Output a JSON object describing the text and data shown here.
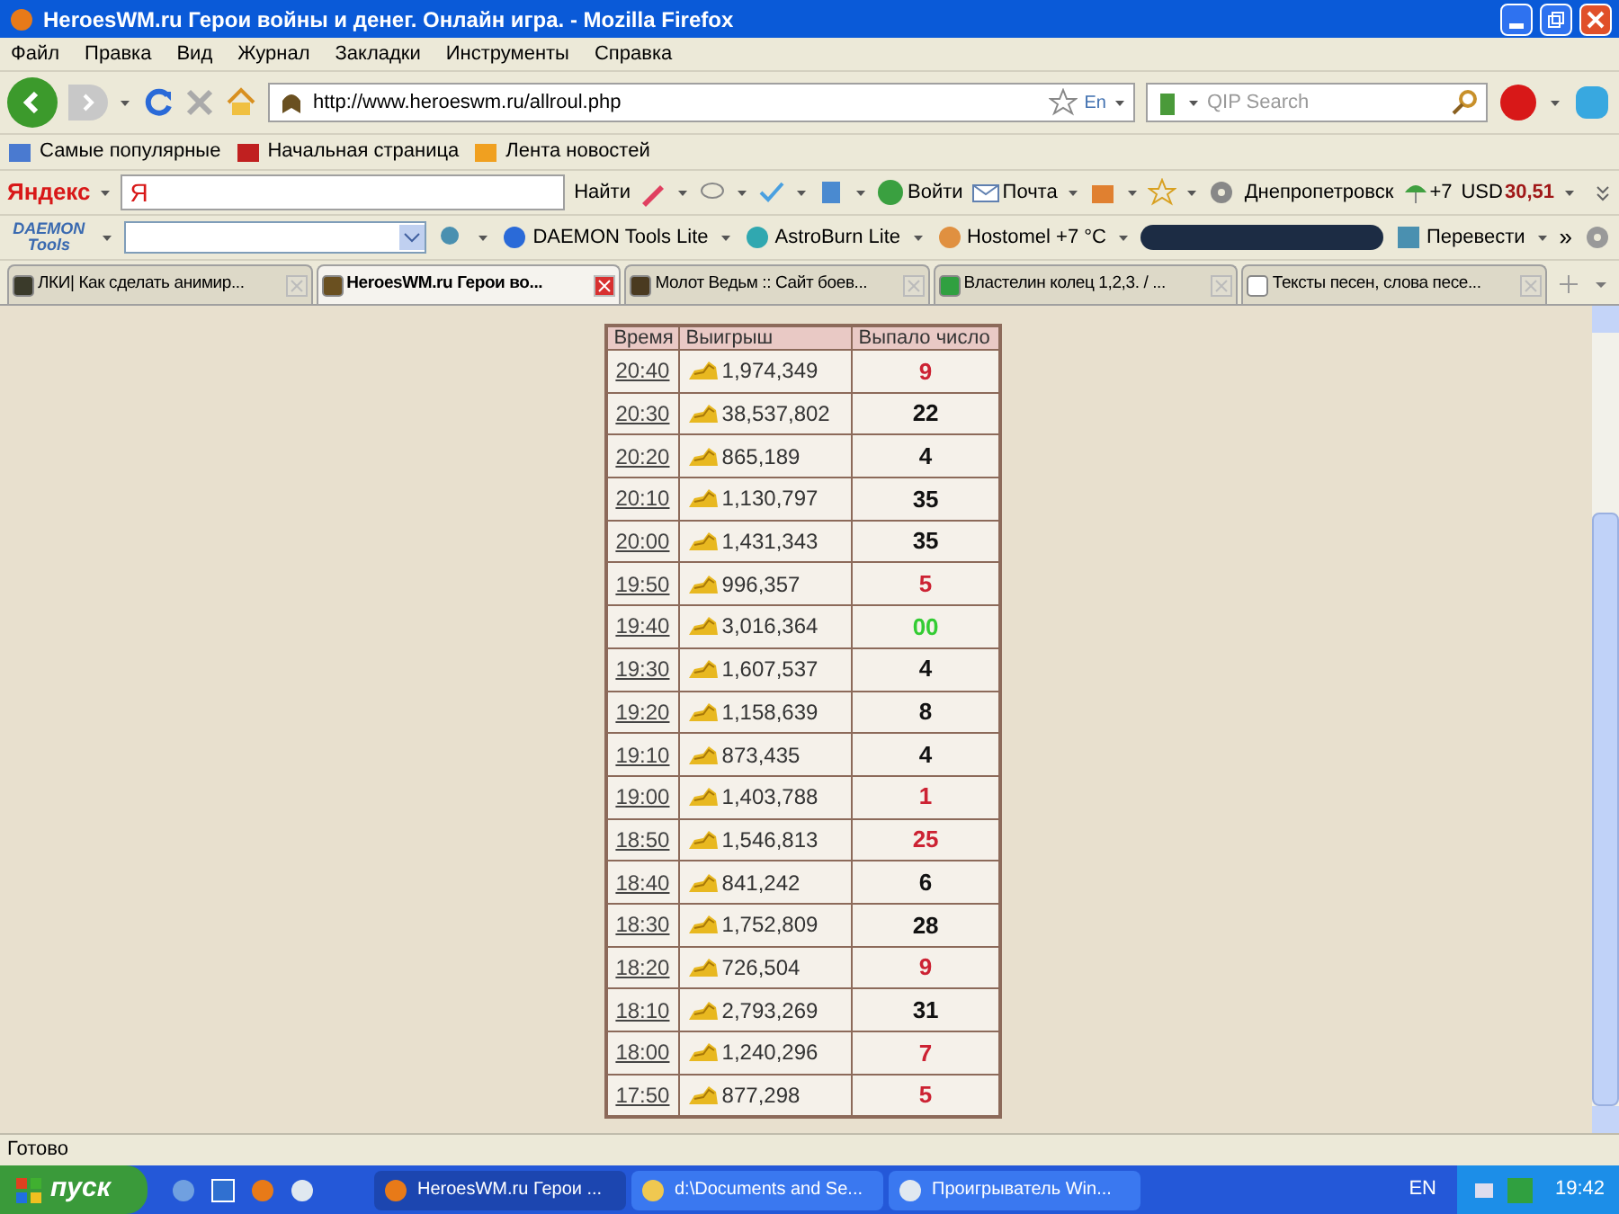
{
  "window": {
    "title": "HeroesWM.ru Герои войны и денег. Онлайн игра. - Mozilla Firefox"
  },
  "menu": [
    "Файл",
    "Правка",
    "Вид",
    "Журнал",
    "Закладки",
    "Инструменты",
    "Справка"
  ],
  "navbar": {
    "url": "http://www.heroeswm.ru/allroul.php",
    "lang": "En",
    "search_placeholder": "QIP Search"
  },
  "bookmarks": [
    "Самые популярные",
    "Начальная страница",
    "Лента новостей"
  ],
  "yandex_bar": {
    "logo": "Яндекс",
    "field_logo": "Я",
    "find": "Найти",
    "login": "Войти",
    "mail": "Почта",
    "city": "Днепропетровск",
    "weather": "+7",
    "currency": "USD",
    "rate": "30,51"
  },
  "daemon_bar": {
    "logo_top": "DAEMON",
    "logo_bottom": "Tools",
    "items": [
      "DAEMON Tools Lite",
      "AstroBurn Lite",
      "Hostomel +7 °C"
    ],
    "translate": "Перевести",
    "more": "»"
  },
  "tabs": [
    {
      "label": "ЛКИ| Как сделать анимир...",
      "selected": false
    },
    {
      "label": "HeroesWM.ru Герои во...",
      "selected": true
    },
    {
      "label": "Молот Ведьм :: Сайт боев...",
      "selected": false
    },
    {
      "label": "Властелин колец 1,2,3. / ...",
      "selected": false
    },
    {
      "label": "Тексты песен, слова песе...",
      "selected": false
    }
  ],
  "table": {
    "columns": [
      "Время",
      "Выигрыш",
      "Выпало число"
    ],
    "rows": [
      {
        "time": "20:40",
        "win": "1,974,349",
        "number": "9",
        "color": "#cc2233"
      },
      {
        "time": "20:30",
        "win": "38,537,802",
        "number": "22",
        "color": "#111111"
      },
      {
        "time": "20:20",
        "win": "865,189",
        "number": "4",
        "color": "#111111"
      },
      {
        "time": "20:10",
        "win": "1,130,797",
        "number": "35",
        "color": "#111111"
      },
      {
        "time": "20:00",
        "win": "1,431,343",
        "number": "35",
        "color": "#111111"
      },
      {
        "time": "19:50",
        "win": "996,357",
        "number": "5",
        "color": "#cc2233"
      },
      {
        "time": "19:40",
        "win": "3,016,364",
        "number": "00",
        "color": "#33cc33"
      },
      {
        "time": "19:30",
        "win": "1,607,537",
        "number": "4",
        "color": "#111111"
      },
      {
        "time": "19:20",
        "win": "1,158,639",
        "number": "8",
        "color": "#111111"
      },
      {
        "time": "19:10",
        "win": "873,435",
        "number": "4",
        "color": "#111111"
      },
      {
        "time": "19:00",
        "win": "1,403,788",
        "number": "1",
        "color": "#cc2233"
      },
      {
        "time": "18:50",
        "win": "1,546,813",
        "number": "25",
        "color": "#cc2233"
      },
      {
        "time": "18:40",
        "win": "841,242",
        "number": "6",
        "color": "#111111"
      },
      {
        "time": "18:30",
        "win": "1,752,809",
        "number": "28",
        "color": "#111111"
      },
      {
        "time": "18:20",
        "win": "726,504",
        "number": "9",
        "color": "#cc2233"
      },
      {
        "time": "18:10",
        "win": "2,793,269",
        "number": "31",
        "color": "#111111"
      },
      {
        "time": "18:00",
        "win": "1,240,296",
        "number": "7",
        "color": "#cc2233"
      },
      {
        "time": "17:50",
        "win": "877,298",
        "number": "5",
        "color": "#cc2233"
      }
    ]
  },
  "status_bar": "Готово",
  "taskbar": {
    "start": "пуск",
    "tasks": [
      "HeroesWM.ru Герои ...",
      "d:\\Documents and Se...",
      "Проигрыватель Win..."
    ],
    "lang": "EN",
    "clock": "19:42"
  }
}
